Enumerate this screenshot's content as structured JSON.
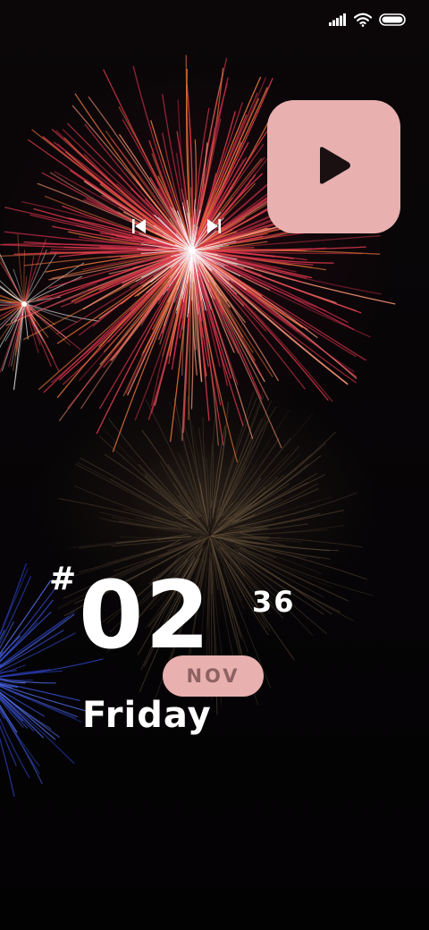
{
  "status_bar": {
    "icons": [
      "signal-icon",
      "wifi-icon",
      "battery-icon"
    ]
  },
  "music_widget": {
    "play_icon": "play-icon",
    "previous_icon": "skip-previous-icon",
    "next_icon": "skip-next-icon",
    "tile_color": "#e9b0b0"
  },
  "clock_widget": {
    "hash": "#",
    "day": "02",
    "minutes": "36",
    "month": "NOV",
    "weekday": "Friday",
    "accent_color": "#e9b0b0",
    "month_text_color": "#8e6262"
  },
  "wallpaper": {
    "burst_colors": [
      "#e23a4e",
      "#f07a3a",
      "#ffffff",
      "#3a55e0"
    ]
  }
}
